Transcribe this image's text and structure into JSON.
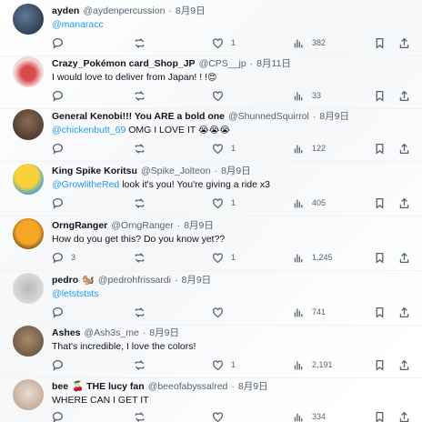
{
  "replies": [
    {
      "display_name": "ayden",
      "handle": "@aydenpercussion",
      "dot": "·",
      "date": "8月9日",
      "badge": "",
      "mention": "@manaracc",
      "text": "",
      "emoji": "",
      "stats": {
        "replies": "",
        "reposts": "",
        "likes": "1",
        "views": "382"
      },
      "avatar_colors": [
        "#1f2a3a",
        "#5f7a9a"
      ]
    },
    {
      "display_name": "Crazy_Pokémon card_Shop_JP",
      "handle": "@CPS__jp",
      "dot": "·",
      "date": "8月11日",
      "badge": "",
      "mention": "",
      "text": "I would love to deliver from Japan! ! !",
      "emoji": "😍",
      "stats": {
        "replies": "",
        "reposts": "",
        "likes": "",
        "views": "33"
      },
      "avatar_colors": [
        "#f5d6d6",
        "#d94a4a"
      ]
    },
    {
      "display_name": "General Kenobi!!! You ARE a bold one",
      "handle": "@ShunnedSquirrol",
      "dot": "·",
      "date": "8月9日",
      "badge": "",
      "mention": "@chickenbutt_69",
      "text": "OMG I LOVE IT",
      "emoji": "😭😭😭",
      "stats": {
        "replies": "",
        "reposts": "",
        "likes": "1",
        "views": "122"
      },
      "avatar_colors": [
        "#3a2c24",
        "#8a6a52"
      ]
    },
    {
      "display_name": "King Spike Koritsu",
      "handle": "@Spike_Jolteon",
      "dot": "·",
      "date": "8月9日",
      "badge": "",
      "mention": "@GrowlitheRed",
      "text": "look it's you! You're giving a ride x3",
      "emoji": "",
      "stats": {
        "replies": "",
        "reposts": "",
        "likes": "1",
        "views": "405"
      },
      "avatar_colors": [
        "#f7d23a",
        "#3aa0d8"
      ]
    },
    {
      "display_name": "OrngRanger",
      "handle": "@OrngRanger",
      "dot": "·",
      "date": "8月9日",
      "badge": "",
      "mention": "",
      "text": "How do you get this? Do you know yet??",
      "emoji": "",
      "stats": {
        "replies": "3",
        "reposts": "",
        "likes": "1",
        "views": "1,245"
      },
      "avatar_colors": [
        "#f5a623",
        "#5a3b1a"
      ]
    },
    {
      "display_name": "pedro",
      "handle": "@pedrohfrissardi",
      "dot": "·",
      "date": "8月9日",
      "badge": "🐿️",
      "mention": "@letstststs",
      "text": "",
      "emoji": "",
      "stats": {
        "replies": "",
        "reposts": "",
        "likes": "",
        "views": "741"
      },
      "avatar_colors": [
        "#e8e8e8",
        "#b9b9b9"
      ]
    },
    {
      "display_name": "Ashes",
      "handle": "@Ash3s_me",
      "dot": "·",
      "date": "8月9日",
      "badge": "",
      "mention": "",
      "text": "That's incredible, I love the colors!",
      "emoji": "",
      "stats": {
        "replies": "",
        "reposts": "",
        "likes": "1",
        "views": "2,191"
      },
      "avatar_colors": [
        "#5b4a3c",
        "#a88a6a"
      ]
    },
    {
      "display_name": "bee",
      "handle": "@beeofabyssalred",
      "dot": "·",
      "date": "8月9日",
      "badge": "🍒 THE lucy fan",
      "mention": "",
      "text": "WHERE CAN I GET IT",
      "emoji": "",
      "stats": {
        "replies": "",
        "reposts": "",
        "likes": "",
        "views": "334"
      },
      "avatar_colors": [
        "#e9ddd0",
        "#b59a86"
      ]
    }
  ],
  "icons": {
    "reply": "reply-icon",
    "repost": "repost-icon",
    "like": "heart-icon",
    "views": "views-icon",
    "bookmark": "bookmark-icon",
    "share": "share-icon"
  },
  "colors": {
    "link": "#1d9bf0",
    "muted": "#536471",
    "text": "#0f1419"
  }
}
